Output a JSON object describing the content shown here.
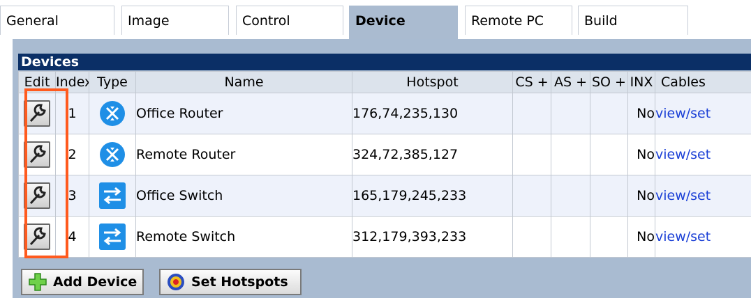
{
  "tabs": [
    "General",
    "Image",
    "Control",
    "Device",
    "Remote PC",
    "Build"
  ],
  "panel": {
    "title": "Devices",
    "columns": [
      "Edit",
      "Index",
      "Type",
      "Name",
      "Hotspot",
      "CS +",
      "AS +",
      "SO +",
      "INX",
      "Cables"
    ]
  },
  "rows": [
    {
      "index": "1",
      "type": "router-icon",
      "name": "Office Router",
      "hotspot": "176,74,235,130",
      "inx": "No",
      "cables": "view/set"
    },
    {
      "index": "2",
      "type": "router-icon",
      "name": "Remote Router",
      "hotspot": "324,72,385,127",
      "inx": "No",
      "cables": "view/set"
    },
    {
      "index": "3",
      "type": "switch-icon",
      "name": "Office Switch",
      "hotspot": "165,179,245,233",
      "inx": "No",
      "cables": "view/set"
    },
    {
      "index": "4",
      "type": "switch-icon",
      "name": "Remote Switch",
      "hotspot": "312,179,393,233",
      "inx": "No",
      "cables": "view/set"
    }
  ],
  "buttons": {
    "add_device": "Add Device",
    "set_hotspots": "Set Hotspots"
  },
  "colors": {
    "panel_bg": "#a9bbd1",
    "header_bg": "#0b2f66",
    "highlight": "#ff5a1e",
    "link": "#1a3fd6",
    "device_icon": "#1f8fe6"
  }
}
